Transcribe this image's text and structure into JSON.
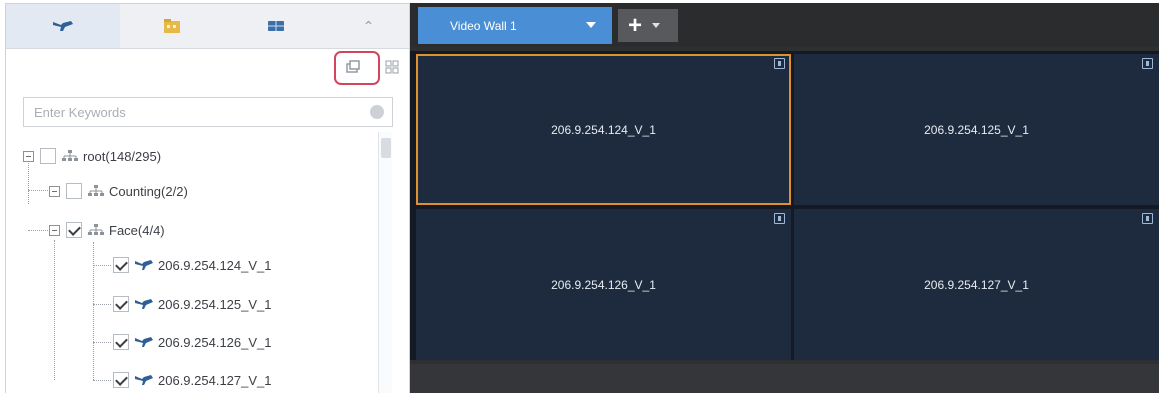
{
  "left_panel": {
    "tabs": [
      {
        "name": "device-tab",
        "icon": "camera-icon"
      },
      {
        "name": "folder-tab",
        "icon": "folder-icon"
      },
      {
        "name": "videowall-tab",
        "icon": "video-wall-icon"
      }
    ],
    "collapse_icon": "chevron-up-icon",
    "search": {
      "placeholder": "Enter Keywords",
      "value": ""
    },
    "tree": {
      "root": {
        "label": "root(148/295)",
        "checked": false
      },
      "groups": [
        {
          "label": "Counting(2/2)",
          "checked": false
        },
        {
          "label": "Face(4/4)",
          "checked": true
        }
      ],
      "devices": [
        {
          "label": "206.9.254.124_V_1",
          "checked": true
        },
        {
          "label": "206.9.254.125_V_1",
          "checked": true
        },
        {
          "label": "206.9.254.126_V_1",
          "checked": true
        },
        {
          "label": "206.9.254.127_V_1",
          "checked": true
        }
      ]
    }
  },
  "video_wall": {
    "tab_label": "Video Wall 1",
    "add_label": "+",
    "cells": [
      {
        "label": "206.9.254.124_V_1",
        "selected": true
      },
      {
        "label": "206.9.254.125_V_1",
        "selected": false
      },
      {
        "label": "206.9.254.126_V_1",
        "selected": false
      },
      {
        "label": "206.9.254.127_V_1",
        "selected": false
      }
    ]
  },
  "colors": {
    "accent": "#4a8fd6",
    "selection": "#e0902f",
    "highlight": "#d3455f",
    "cell_bg": "#1e2b3e"
  }
}
